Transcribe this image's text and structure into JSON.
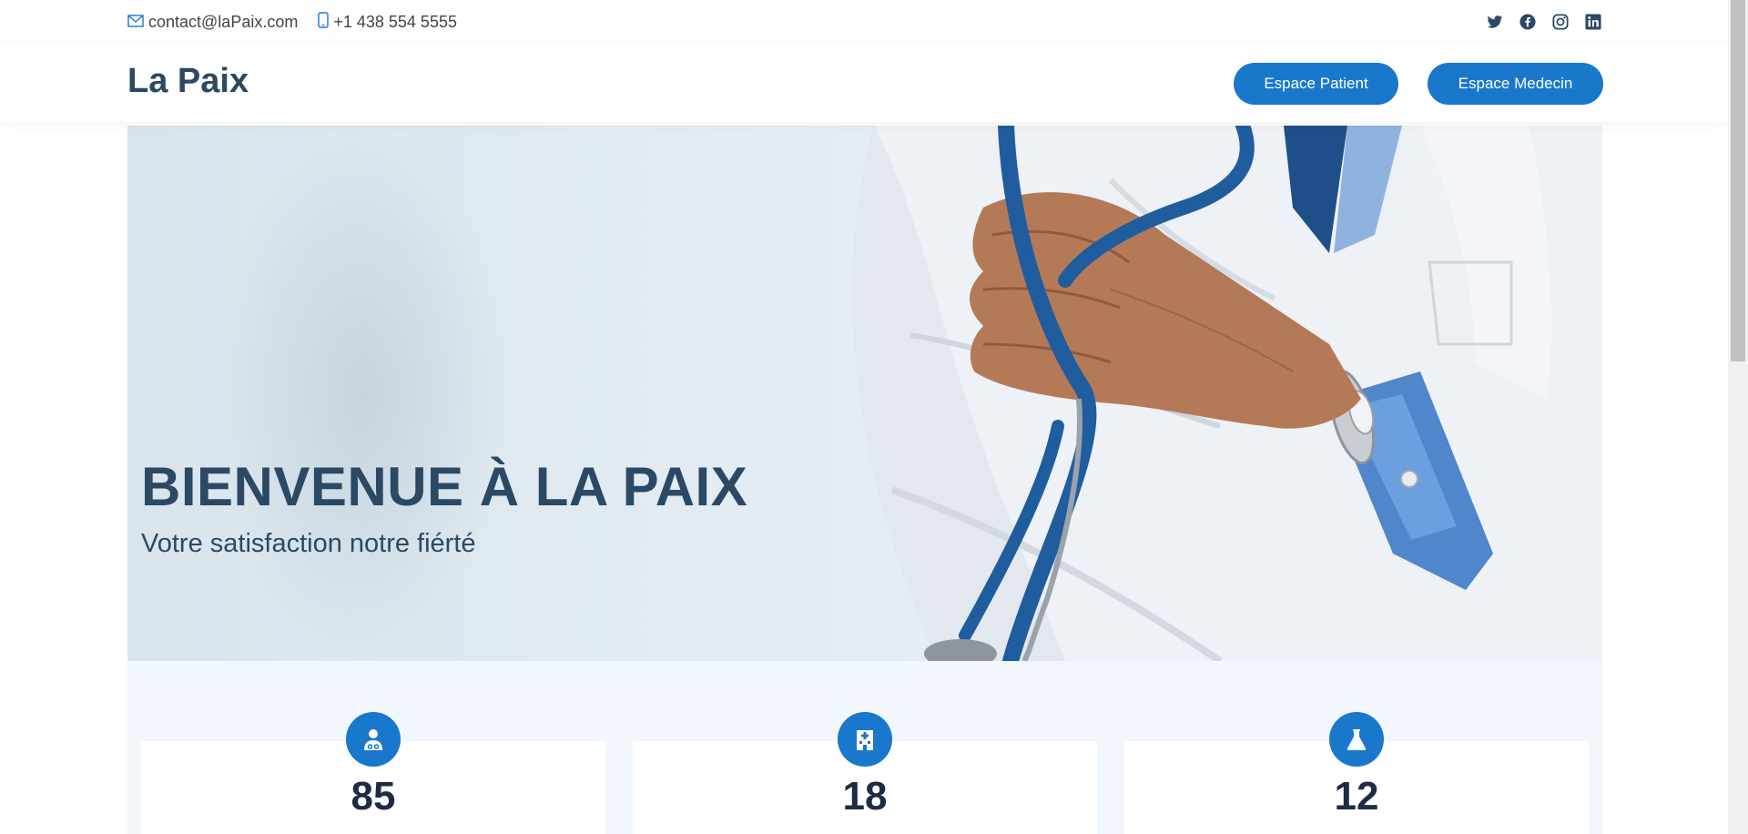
{
  "topbar": {
    "email": "contact@laPaix.com",
    "phone": "+1 438 554 5555",
    "social": [
      "twitter-icon",
      "facebook-icon",
      "instagram-icon",
      "linkedin-icon"
    ]
  },
  "header": {
    "logo": "La Paix",
    "patient_button": "Espace Patient",
    "medecin_button": "Espace Medecin"
  },
  "hero": {
    "title": "BIENVENUE À LA PAIX",
    "subtitle": "Votre satisfaction notre fiérté"
  },
  "stats": [
    {
      "icon": "doctor-icon",
      "value": "85"
    },
    {
      "icon": "hospital-icon",
      "value": "18"
    },
    {
      "icon": "flask-icon",
      "value": "12"
    }
  ],
  "colors": {
    "primary": "#1977cc",
    "heading": "#2c4964",
    "stats_bg": "#f1f7fd"
  }
}
